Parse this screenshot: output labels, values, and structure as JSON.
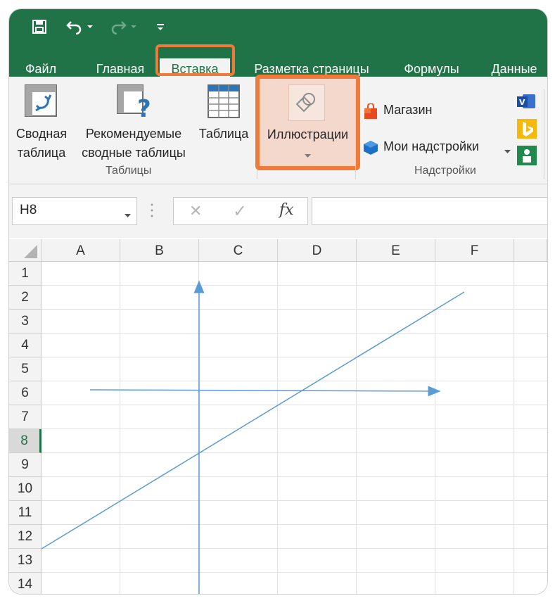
{
  "quick_access": {
    "save": "save-icon",
    "undo": "undo-icon",
    "redo": "redo-icon",
    "customize": "customize-qat-icon"
  },
  "tabs": [
    {
      "label": "Файл"
    },
    {
      "label": "Главная"
    },
    {
      "label": "Вставка"
    },
    {
      "label": "Разметка страницы"
    },
    {
      "label": "Формулы"
    },
    {
      "label": "Данные"
    }
  ],
  "ribbon": {
    "pivot_table": {
      "line1": "Сводная",
      "line2": "таблица"
    },
    "recommended_pivot": {
      "line1": "Рекомендуемые",
      "line2": "сводные таблицы"
    },
    "table": {
      "line1": "Таблица"
    },
    "illustrations": {
      "line1": "Иллюстрации"
    },
    "store": "Магазин",
    "my_addins": "Мои надстройки",
    "group_tables": "Таблицы",
    "group_addins": "Надстройки"
  },
  "formula_bar": {
    "name_box": "H8",
    "cancel_symbol": "✕",
    "enter_symbol": "✓",
    "fx_symbol": "fx",
    "formula_value": ""
  },
  "grid": {
    "columns": [
      "A",
      "B",
      "C",
      "D",
      "E",
      "F"
    ],
    "rows": [
      "1",
      "2",
      "3",
      "4",
      "5",
      "6",
      "7",
      "8",
      "9",
      "10",
      "11",
      "12",
      "13",
      "14"
    ],
    "selected_row": "8"
  },
  "colors": {
    "excel_green": "#207346",
    "highlight_orange": "#f07a3a",
    "line_blue": "#5b9bd5"
  }
}
